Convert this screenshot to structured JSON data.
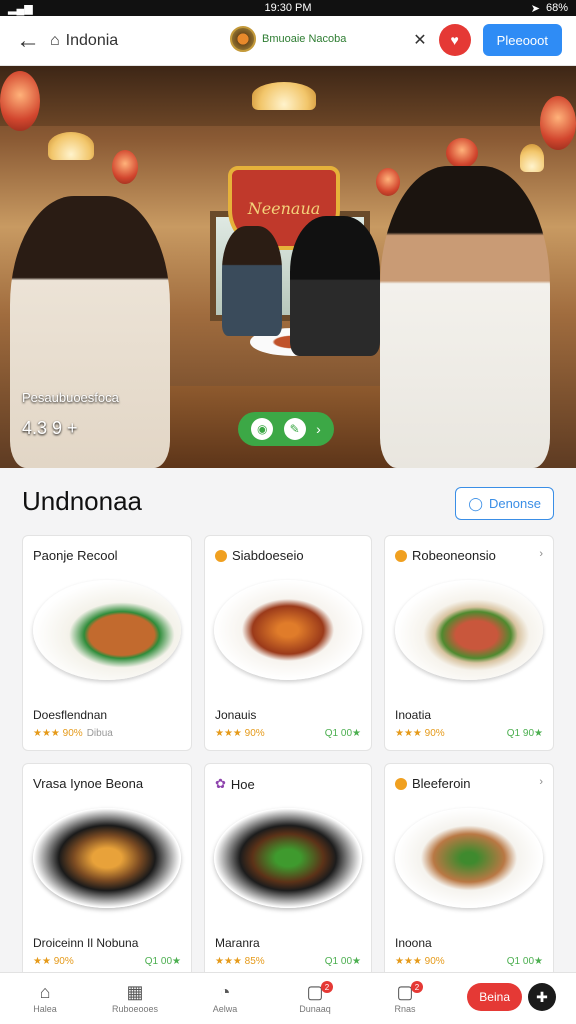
{
  "status": {
    "time": "19:30 PM",
    "battery": "68%"
  },
  "appbar": {
    "back_icon": "arrow-left-icon",
    "home_label": "Indonia",
    "brand_label": "Bmuoaie Nacoba",
    "close_icon": "x-icon",
    "action_label": "Pleeooot"
  },
  "hero": {
    "sign_text": "Neenaua",
    "caption": "Pesaubuoesfoca",
    "rating_text": "4.3 9 +"
  },
  "section": {
    "title": "Undnonaa",
    "button_label": "Denonse"
  },
  "cards": [
    {
      "title": "Paonje Recool",
      "name": "Doesflendnan",
      "rating": "★★★ 90%",
      "meta": "Dibua",
      "price": "",
      "dish_colors": [
        "#f4f2ea",
        "#c26a2e",
        "#2f8c3a"
      ]
    },
    {
      "title": "Siabdoeseio",
      "name": "Jonauis",
      "rating": "★★★ 90%",
      "meta": "",
      "price": "Q1 00★",
      "dish_colors": [
        "#f7f4ef",
        "#9b3a1a",
        "#e07c2a"
      ]
    },
    {
      "title": "Robeoneonsio",
      "name": "Inoatia",
      "rating": "★★★ 90%",
      "meta": "",
      "price": "Q1 90★",
      "dish_colors": [
        "#f6f3ec",
        "#c9573c",
        "#4f8a2f"
      ]
    },
    {
      "title": "Vrasa Iynoe Beona",
      "name": "Droiceinn Il Nobuna",
      "rating": "★★ 90%",
      "meta": "",
      "price": "Q1 00★",
      "dish_colors": [
        "#1a1a1a",
        "#7a4a22",
        "#e8a23a"
      ]
    },
    {
      "title": "Hoe",
      "name": "Maranra",
      "rating": "★★★ 85%",
      "meta": "",
      "price": "Q1 00★",
      "dish_colors": [
        "#1c1c1c",
        "#5c3218",
        "#3f9a2e"
      ]
    },
    {
      "title": "Bleeferoin",
      "name": "Inoona",
      "rating": "★★★ 90%",
      "meta": "",
      "price": "Q1 00★",
      "dish_colors": [
        "#f5f3ee",
        "#b97844",
        "#3f8a2e"
      ]
    }
  ],
  "nav": [
    {
      "icon": "home-icon",
      "glyph": "⌂",
      "label": "Halea",
      "badge": ""
    },
    {
      "icon": "calendar-icon",
      "glyph": "▦",
      "label": "Ruboeooes",
      "badge": ""
    },
    {
      "icon": "compass-icon",
      "glyph": "◔",
      "label": "Aelwa",
      "badge": ""
    },
    {
      "icon": "chat-icon",
      "glyph": "▢",
      "label": "Dunaaq",
      "badge": "2"
    },
    {
      "icon": "bag-icon",
      "glyph": "▢",
      "label": "Rnas",
      "badge": "2"
    }
  ],
  "nav_cta": {
    "label": "Beina",
    "icon": "cart-icon"
  }
}
